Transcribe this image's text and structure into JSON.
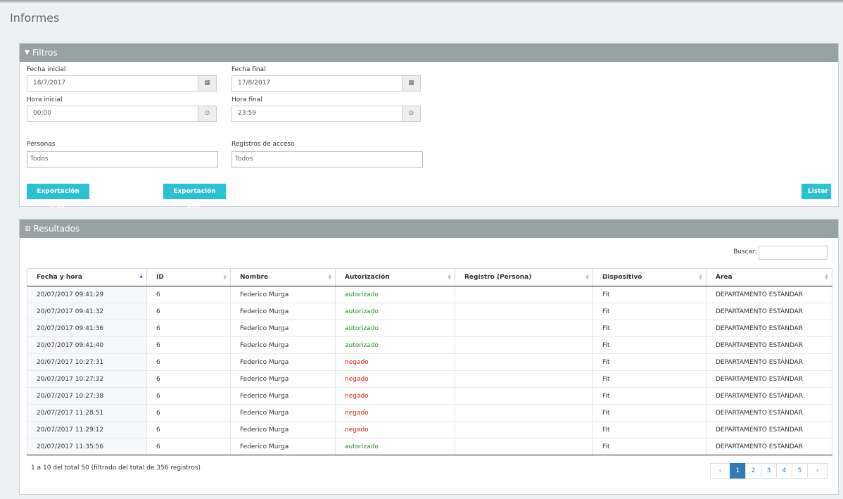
{
  "page": {
    "title": "Informes"
  },
  "filters": {
    "header": "Filtros",
    "fecha_inicial": {
      "label": "Fecha inicial",
      "value": "18/7/2017"
    },
    "fecha_final": {
      "label": "Fecha final",
      "value": "17/8/2017"
    },
    "hora_inicial": {
      "label": "Hora inicial",
      "value": "00:00"
    },
    "hora_final": {
      "label": "Hora final",
      "value": "23:59"
    },
    "personas": {
      "label": "Personas",
      "value": "Todos"
    },
    "registros": {
      "label": "Registros de acceso",
      "value": "Todos"
    },
    "btn_csv": "Exportación CSV",
    "btn_pdf": "Exportación PDF",
    "btn_listar": "Listar"
  },
  "results": {
    "header": "Resultados",
    "search_label": "Buscar:",
    "search_value": "",
    "columns": [
      "Fecha y hora",
      "ID",
      "Nombre",
      "Autorización",
      "Registro (Persona)",
      "Dispositivo",
      "Área"
    ],
    "rows": [
      {
        "fecha": "20/07/2017 09:41:29",
        "id": "6",
        "nombre": "Federico Murga",
        "auth": "autorizado",
        "registro": "",
        "dispositivo": "Fit",
        "area": "DEPARTAMENTO ESTÁNDAR"
      },
      {
        "fecha": "20/07/2017 09:41:32",
        "id": "6",
        "nombre": "Federico Murga",
        "auth": "autorizado",
        "registro": "",
        "dispositivo": "Fit",
        "area": "DEPARTAMENTO ESTÁNDAR"
      },
      {
        "fecha": "20/07/2017 09:41:36",
        "id": "6",
        "nombre": "Federico Murga",
        "auth": "autorizado",
        "registro": "",
        "dispositivo": "Fit",
        "area": "DEPARTAMENTO ESTÁNDAR"
      },
      {
        "fecha": "20/07/2017 09:41:40",
        "id": "6",
        "nombre": "Federico Murga",
        "auth": "autorizado",
        "registro": "",
        "dispositivo": "Fit",
        "area": "DEPARTAMENTO ESTÁNDAR"
      },
      {
        "fecha": "20/07/2017 10:27:31",
        "id": "6",
        "nombre": "Federico Murga",
        "auth": "negado",
        "registro": "",
        "dispositivo": "Fit",
        "area": "DEPARTAMENTO ESTÁNDAR"
      },
      {
        "fecha": "20/07/2017 10:27:32",
        "id": "6",
        "nombre": "Federico Murga",
        "auth": "negado",
        "registro": "",
        "dispositivo": "Fit",
        "area": "DEPARTAMENTO ESTÁNDAR"
      },
      {
        "fecha": "20/07/2017 10:27:38",
        "id": "6",
        "nombre": "Federico Murga",
        "auth": "negado",
        "registro": "",
        "dispositivo": "Fit",
        "area": "DEPARTAMENTO ESTÁNDAR"
      },
      {
        "fecha": "20/07/2017 11:28:51",
        "id": "6",
        "nombre": "Federico Murga",
        "auth": "negado",
        "registro": "",
        "dispositivo": "Fit",
        "area": "DEPARTAMENTO ESTÁNDAR"
      },
      {
        "fecha": "20/07/2017 11:29:12",
        "id": "6",
        "nombre": "Federico Murga",
        "auth": "negado",
        "registro": "",
        "dispositivo": "Fit",
        "area": "DEPARTAMENTO ESTÁNDAR"
      },
      {
        "fecha": "20/07/2017 11:35:56",
        "id": "6",
        "nombre": "Federico Murga",
        "auth": "autorizado",
        "registro": "",
        "dispositivo": "Fit",
        "area": "DEPARTAMENTO ESTÁNDAR"
      }
    ],
    "info": "1 a 10 del total 50 (filtrado del total de 356 registros)",
    "pagination": {
      "prev": "‹",
      "pages": [
        "1",
        "2",
        "3",
        "4",
        "5"
      ],
      "active": "1",
      "next": "›"
    }
  },
  "icons": {
    "filter": "filter-icon",
    "chart": "bar-chart-icon",
    "calendar": "calendar-icon",
    "clock": "clock-icon",
    "sort": "sort-icon"
  },
  "colors": {
    "panel_header": "#97a3a2",
    "button": "#2bc0d2",
    "authorized": "#2e8b2e",
    "denied": "#e02020",
    "pager_active": "#337ab7"
  }
}
